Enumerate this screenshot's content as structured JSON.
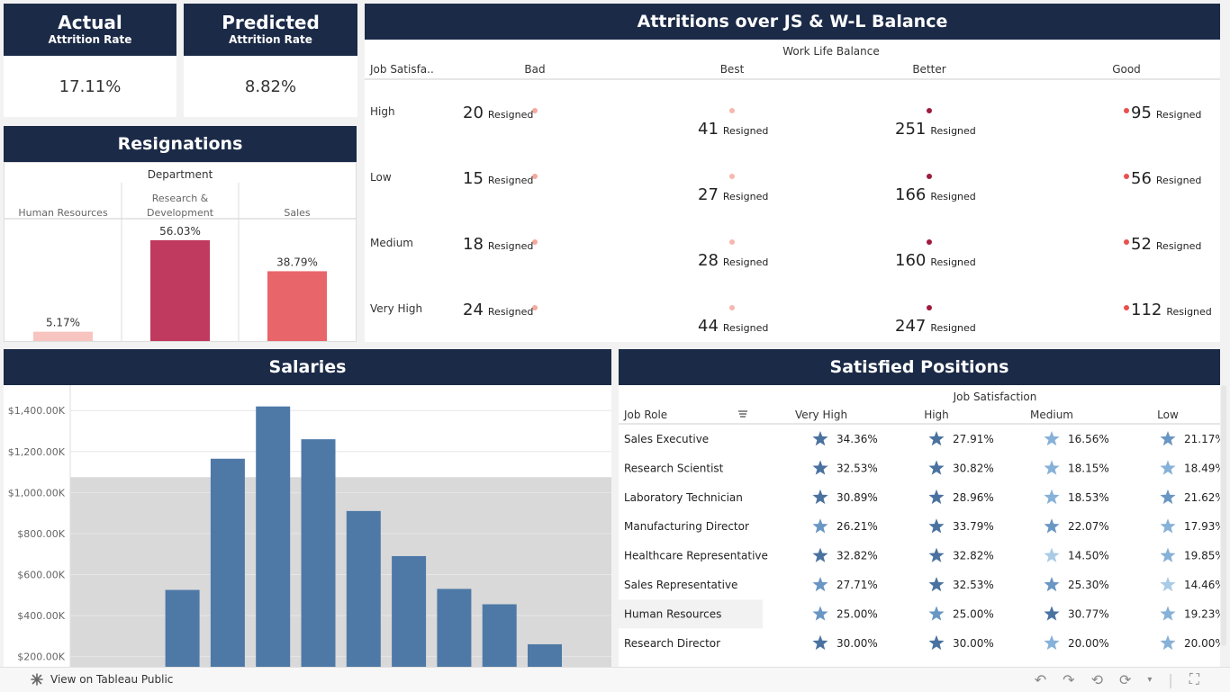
{
  "kpis": [
    {
      "title": "Actual",
      "subtitle": "Attrition Rate",
      "value": "17.11%"
    },
    {
      "title": "Predicted",
      "subtitle": "Attrition Rate",
      "value": "8.82%"
    }
  ],
  "resignations": {
    "title": "Resignations",
    "dim_header": "Department",
    "chart_type": "bar",
    "categories": [
      "Human Resources",
      "Research & Development",
      "Sales"
    ],
    "values": [
      5.17,
      56.03,
      38.79
    ],
    "labels": [
      "5.17%",
      "56.03%",
      "38.79%"
    ],
    "colors": [
      "#f8c4bf",
      "#c0395e",
      "#e8656a"
    ]
  },
  "attritions": {
    "title": "Attritions over JS & W-L Balance",
    "col_header": "Work Life Balance",
    "row_header": "Job Satisfa..",
    "columns": [
      "Bad",
      "Best",
      "Better",
      "Good"
    ],
    "rows": [
      "High",
      "Low",
      "Medium",
      "Very High"
    ],
    "unit_label": "Resigned",
    "values": [
      [
        20,
        41,
        251,
        95
      ],
      [
        15,
        27,
        166,
        56
      ],
      [
        18,
        28,
        160,
        52
      ],
      [
        24,
        44,
        247,
        112
      ]
    ]
  },
  "salaries": {
    "title": "Salaries",
    "chart_type": "bar",
    "values": [
      0,
      140,
      525,
      1165,
      1420,
      1260,
      910,
      690,
      530,
      455,
      260
    ],
    "y_ticks": [
      200,
      400,
      600,
      800,
      1000,
      1200,
      1400
    ],
    "y_tick_labels": [
      "$200.00K",
      "$400.00K",
      "$600.00K",
      "$800.00K",
      "$1,000.00K",
      "$1,200.00K",
      "$1,400.00K"
    ],
    "ylim": [
      150,
      1480
    ],
    "band": [
      150,
      1075
    ],
    "bar_color": "#4e79a7",
    "band_color": "#d9d9d9"
  },
  "satisfied": {
    "title": "Satisfied Positions",
    "col_header": "Job Satisfaction",
    "row_header": "Job Role",
    "columns": [
      "Very High",
      "High",
      "Medium",
      "Low"
    ],
    "rows": [
      {
        "role": "Sales Executive",
        "values": [
          "34.36%",
          "27.91%",
          "16.56%",
          "21.17%"
        ],
        "shades": [
          3,
          3,
          1,
          2
        ]
      },
      {
        "role": "Research Scientist",
        "values": [
          "32.53%",
          "30.82%",
          "18.15%",
          "18.49%"
        ],
        "shades": [
          3,
          3,
          1,
          1
        ]
      },
      {
        "role": "Laboratory Technician",
        "values": [
          "30.89%",
          "28.96%",
          "18.53%",
          "21.62%"
        ],
        "shades": [
          3,
          3,
          1,
          2
        ]
      },
      {
        "role": "Manufacturing Director",
        "values": [
          "26.21%",
          "33.79%",
          "22.07%",
          "17.93%"
        ],
        "shades": [
          2,
          3,
          2,
          1
        ]
      },
      {
        "role": "Healthcare Representative",
        "values": [
          "32.82%",
          "32.82%",
          "14.50%",
          "19.85%"
        ],
        "shades": [
          3,
          3,
          0,
          1
        ]
      },
      {
        "role": "Sales Representative",
        "values": [
          "27.71%",
          "32.53%",
          "25.30%",
          "14.46%"
        ],
        "shades": [
          2,
          3,
          2,
          0
        ]
      },
      {
        "role": "Human Resources",
        "values": [
          "25.00%",
          "25.00%",
          "30.77%",
          "19.23%"
        ],
        "shades": [
          2,
          2,
          3,
          1
        ]
      },
      {
        "role": "Research Director",
        "values": [
          "30.00%",
          "30.00%",
          "20.00%",
          "20.00%"
        ],
        "shades": [
          3,
          3,
          1,
          1
        ]
      }
    ],
    "shade_colors": [
      "#a9cbe6",
      "#86b1d8",
      "#6996c3",
      "#4a72a0"
    ]
  },
  "footer": {
    "view_label": "View on Tableau Public"
  }
}
